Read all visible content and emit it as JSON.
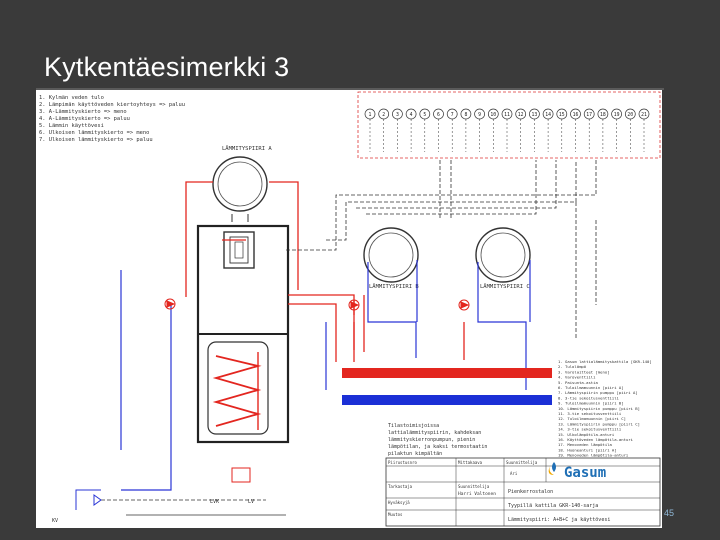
{
  "slide": {
    "title": "Kytkentäesimerkki 3",
    "page_number": "45"
  },
  "diagram": {
    "legend_lines": [
      "1. Kylmän veden tulo",
      "2. Lämpimän käyttöveden kiertoyhteys => paluu",
      "3. A-Lämmityskierto => meno",
      "4. A-Lämmityskierto => paluu",
      "5. Lämmin käyttövesi",
      "6. Ulkoisen lämmityskierto => meno",
      "7. Ulkoisen lämmityskierto => paluu"
    ],
    "circuit_a": "LÄMMITYSPIIRI A",
    "circuit_b": "LÄMMITYSPIIRI B",
    "circuit_c": "LÄMMITYSPIIRI C",
    "terminals": [
      "1",
      "2",
      "3",
      "4",
      "5",
      "6",
      "7",
      "8",
      "9",
      "10",
      "11",
      "12",
      "13",
      "14",
      "15",
      "16",
      "17",
      "18",
      "19",
      "20",
      "21"
    ],
    "component_list": [
      "1. Gasum lattialämmityskattila [GKR-140]",
      "2. Tulolämpö",
      "3. Varolaitteet [meno]",
      "4. Varoventtiili",
      "5. Paisunta-astia",
      "6. Tuloilmamuunnin [piiri A]",
      "7. Lämmityspiirin pumppu [piiri A]",
      "8. 3-tie sekoitusventtiili",
      "9. Tuloilmamuunnin [piiri B]",
      "10. Lämmityspiirin pumppu [piiri B]",
      "11. 3-tie sekoitusventtiili",
      "12. Tuloilmamuunnin [piiri C]",
      "13. Lämmityspiirin pumppu [piiri C]",
      "14. 3-tie sekoitusventtiili",
      "15. Ulkolämpötila-anturi",
      "16. Käyttöveden lämpötila-anturi",
      "17. Menoveden lämpötila",
      "18. Huoneanturi [piiri A]",
      "19. Menoveden lämpötila-anturi",
      "20. Huoneanturi [piiri B]",
      "21. Menoveden lämpötila-anturi",
      "22. Huoneanturi [piiri C]",
      "23. Pikaventtiili",
      "24. Lämmin vesi"
    ],
    "note_lines": [
      "Tilastoimisjoissa",
      "lattialämmityspiirin, kahdeksan",
      "lämmityskierronpumpun, pienin",
      "lämpötilan, ja kaksi termostaatin",
      "pilaktun kimpältän"
    ],
    "labels": {
      "lvk": "LVK",
      "lv": "LV",
      "kv": "KV"
    }
  },
  "title_block": {
    "company_label": "Gasum",
    "row1_labels": [
      "Piirustusnro",
      "Mittakaava",
      "Suunnittelija"
    ],
    "row1_values": [
      "",
      "",
      "Ari"
    ],
    "name_label": "Nimi",
    "designer_label": "Suunnittelija",
    "designer_value": "Harri      Valtonen",
    "desc_lines": [
      "Pienkerrostalon",
      "Tyypillä kattila GKR-140-sarja",
      "Lämmityspiiri: A+B+C  ja käyttövesi"
    ],
    "left_labels": [
      "Tarkastaja",
      "Hyväksyjä",
      "Muutos"
    ]
  }
}
